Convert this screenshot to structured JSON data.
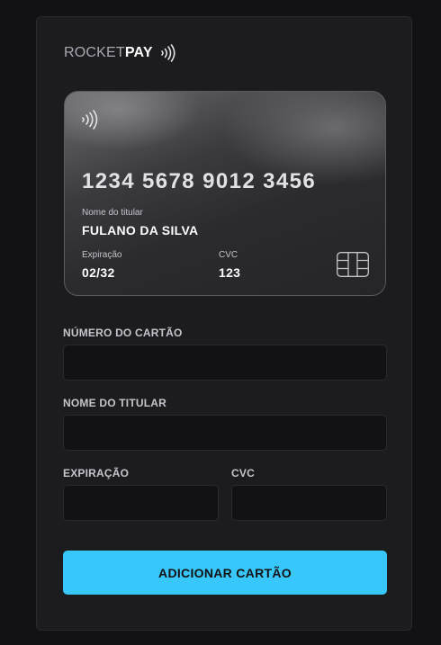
{
  "brand": {
    "name_part1": "ROCKET",
    "name_part2": "PAY"
  },
  "card": {
    "number": "1234 5678 9012 3456",
    "holder_label": "Nome do titular",
    "holder_value": "FULANO DA SILVA",
    "expiry_label": "Expiração",
    "expiry_value": "02/32",
    "cvc_label": "CVC",
    "cvc_value": "123"
  },
  "form": {
    "number_label": "NÚMERO DO CARTÃO",
    "number_value": "",
    "holder_label": "NOME DO TITULAR",
    "holder_value": "",
    "expiry_label": "EXPIRAÇÃO",
    "expiry_value": "",
    "cvc_label": "CVC",
    "cvc_value": "",
    "submit_label": "ADICIONAR CARTÃO"
  },
  "colors": {
    "accent": "#38c7fd",
    "background": "#121214",
    "panel": "#1c1c1f"
  },
  "icons": {
    "brand_icon": "contactless-icon",
    "card_icon": "contactless-icon",
    "chip_icon": "card-chip-icon"
  }
}
